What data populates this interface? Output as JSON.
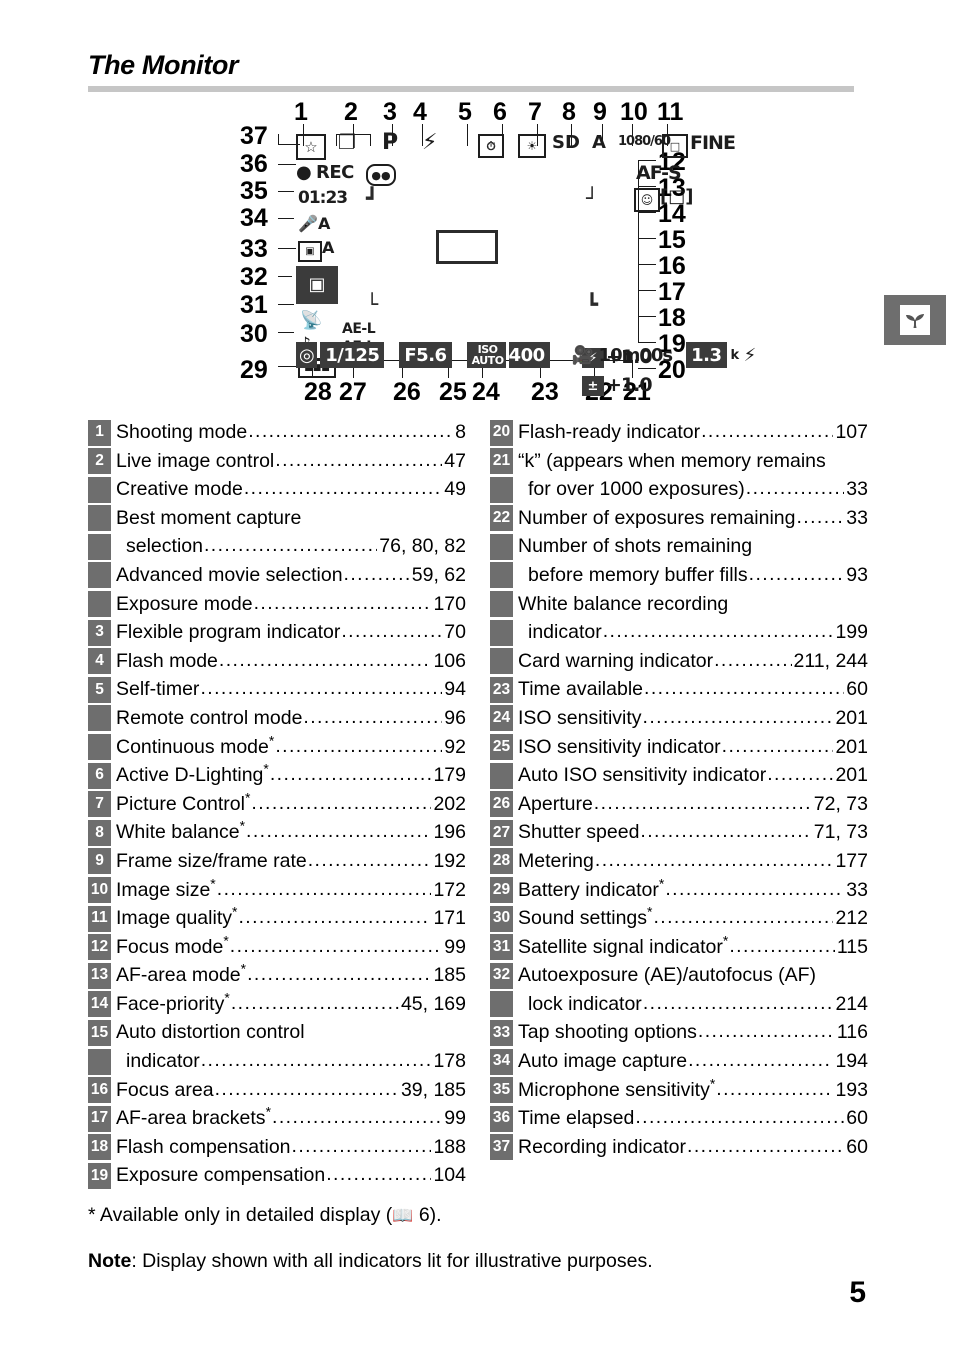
{
  "header": {
    "title": "The Monitor"
  },
  "side_tab": {
    "icon": "sprout-icon"
  },
  "figure": {
    "caption_numbers_top": [
      "1",
      "2",
      "3",
      "4",
      "5",
      "6",
      "7",
      "8",
      "9",
      "10",
      "11"
    ],
    "caption_numbers_bottom": [
      "28",
      "27",
      "26",
      "25",
      "24",
      "23",
      "22",
      "21"
    ],
    "caption_numbers_left": [
      "37",
      "36",
      "35",
      "34",
      "33",
      "32",
      "31",
      "30",
      "29"
    ],
    "caption_numbers_right": [
      "12",
      "13",
      "14",
      "15",
      "16",
      "17",
      "18",
      "19",
      "20"
    ],
    "display": {
      "shooting_mode_icon": "star-frame-icon",
      "live_image_control_icon": "stacked-frames-icon",
      "flexible_program": "P",
      "flash_mode_icon": "lightning-bolt-icon",
      "self_timer_icon": "self-timer-icon",
      "active_d_lighting_icon": "d-lighting-icon",
      "picture_control": "SD",
      "white_balance": "A",
      "frame_size_rate": "1080/60",
      "image_size_icon": "image-size-icon",
      "image_quality": "FINE",
      "focus_mode": "AF-S",
      "face_priority_icon": "face-priority-icon",
      "af_area_mode_icon": "af-area-mode-icon",
      "recording_indicator": "REC",
      "time_elapsed": "01:23",
      "microphone_sensitivity_icon": "microphone-icon",
      "microphone_level": "A",
      "auto_image_capture_icon": "auto-capture-icon",
      "auto_capture_level": "A",
      "tap_shooting_icon": "tap-shooting-icon",
      "satellite_icon": "satellite-icon",
      "sound_icon": "music-note-icon",
      "battery_icon": "battery-icon",
      "ae_lock": "AE-L",
      "af_lock": "AF-L",
      "metering_icon": "metering-icon",
      "shutter_speed": "1/125",
      "aperture": "F5.6",
      "iso_label": "ISO",
      "iso_auto_label": "AUTO",
      "iso_value": "400",
      "movie_icon": "movie-camera-icon",
      "time_available": "10m00s",
      "exposures_remaining": "1.3",
      "k_indicator": "k",
      "flash_ready_icon": "flash-ready-icon",
      "flash_compensation": "+1.0",
      "exposure_compensation": "+1.0",
      "flash_comp_icon": "flash-compensation-icon",
      "exp_comp_icon": "exposure-compensation-icon"
    }
  },
  "legend": {
    "left": [
      {
        "num": "1",
        "label": "Shooting mode",
        "page": "8",
        "indent": false
      },
      {
        "num": "2",
        "label": "Live image control",
        "page": "47",
        "indent": false
      },
      {
        "num": "",
        "label": "Creative mode ",
        "page": "49",
        "indent": false
      },
      {
        "num": "",
        "label": "Best moment capture",
        "page": "",
        "indent": false,
        "nodots": true
      },
      {
        "num": "",
        "label": "selection",
        "page": "76, 80, 82",
        "indent": true
      },
      {
        "num": "",
        "label": "Advanced movie selection",
        "page": "59, 62",
        "indent": false
      },
      {
        "num": "",
        "label": "Exposure mode",
        "page": "170",
        "indent": false
      },
      {
        "num": "3",
        "label": "Flexible program indicator",
        "page": "70",
        "indent": false
      },
      {
        "num": "4",
        "label": "Flash mode",
        "page": "106",
        "indent": false
      },
      {
        "num": "5",
        "label": "Self-timer",
        "page": "94",
        "indent": false
      },
      {
        "num": "",
        "label": "Remote control mode",
        "page": "96",
        "indent": false
      },
      {
        "num": "",
        "label": "Continuous mode",
        "page": "92",
        "indent": false,
        "star": true
      },
      {
        "num": "6",
        "label": "Active D-Lighting",
        "page": "179",
        "indent": false,
        "star": true
      },
      {
        "num": "7",
        "label": "Picture Control",
        "page": "202",
        "indent": false,
        "star": true
      },
      {
        "num": "8",
        "label": "White balance",
        "page": "196",
        "indent": false,
        "star": true
      },
      {
        "num": "9",
        "label": "Frame size/frame rate",
        "page": "192",
        "indent": false
      },
      {
        "num": "10",
        "label": "Image size",
        "page": "172",
        "indent": false,
        "star": true
      },
      {
        "num": "11",
        "label": "Image quality",
        "page": "171",
        "indent": false,
        "star": true
      },
      {
        "num": "12",
        "label": "Focus mode",
        "page": "99",
        "indent": false,
        "star": true
      },
      {
        "num": "13",
        "label": "AF-area mode",
        "page": "185",
        "indent": false,
        "star": true
      },
      {
        "num": "14",
        "label": "Face-priority",
        "page": "45, 169",
        "indent": false,
        "star": true
      },
      {
        "num": "15",
        "label": "Auto distortion control",
        "page": "",
        "indent": false,
        "nodots": true
      },
      {
        "num": "",
        "label": "indicator",
        "page": "178",
        "indent": true
      },
      {
        "num": "16",
        "label": "Focus area",
        "page": "39, 185",
        "indent": false
      },
      {
        "num": "17",
        "label": "AF-area brackets",
        "page": "99",
        "indent": false,
        "star": true
      },
      {
        "num": "18",
        "label": "Flash compensation",
        "page": "188",
        "indent": false
      },
      {
        "num": "19",
        "label": "Exposure compensation",
        "page": "104",
        "indent": false
      }
    ],
    "right": [
      {
        "num": "20",
        "label": "Flash-ready indicator",
        "page": "107",
        "indent": false
      },
      {
        "num": "21",
        "label": "“k” (appears when memory remains",
        "page": "",
        "indent": false,
        "nodots": true
      },
      {
        "num": "",
        "label": "for over 1000 exposures)",
        "page": "33",
        "indent": true
      },
      {
        "num": "22",
        "label": "Number of exposures remaining",
        "page": "33",
        "indent": false
      },
      {
        "num": "",
        "label": "Number of shots remaining",
        "page": "",
        "indent": false,
        "nodots": true
      },
      {
        "num": "",
        "label": "before memory buffer fills",
        "page": "93",
        "indent": true
      },
      {
        "num": "",
        "label": "White balance recording",
        "page": "",
        "indent": false,
        "nodots": true
      },
      {
        "num": "",
        "label": "indicator",
        "page": "199",
        "indent": true
      },
      {
        "num": "",
        "label": "Card warning indicator",
        "page": "211, 244",
        "indent": false
      },
      {
        "num": "23",
        "label": "Time available",
        "page": "60",
        "indent": false
      },
      {
        "num": "24",
        "label": "ISO sensitivity",
        "page": "201",
        "indent": false
      },
      {
        "num": "25",
        "label": "ISO sensitivity indicator",
        "page": "201",
        "indent": false
      },
      {
        "num": "",
        "label": "Auto ISO sensitivity indicator",
        "page": "201",
        "indent": false
      },
      {
        "num": "26",
        "label": "Aperture",
        "page": "72, 73",
        "indent": false
      },
      {
        "num": "27",
        "label": "Shutter speed",
        "page": "71, 73",
        "indent": false
      },
      {
        "num": "28",
        "label": "Metering",
        "page": "177",
        "indent": false
      },
      {
        "num": "29",
        "label": "Battery indicator",
        "page": "33",
        "indent": false,
        "star": true
      },
      {
        "num": "30",
        "label": "Sound settings",
        "page": "212",
        "indent": false,
        "star": true
      },
      {
        "num": "31",
        "label": "Satellite signal indicator",
        "page": "115",
        "indent": false,
        "star": true
      },
      {
        "num": "32",
        "label": "Autoexposure (AE)/autofocus (AF)",
        "page": "",
        "indent": false,
        "nodots": true
      },
      {
        "num": "",
        "label": "lock indicator",
        "page": "214",
        "indent": true
      },
      {
        "num": "33",
        "label": "Tap shooting options",
        "page": "116",
        "indent": false
      },
      {
        "num": "34",
        "label": "Auto image capture",
        "page": "194",
        "indent": false
      },
      {
        "num": "35",
        "label": "Microphone sensitivity",
        "page": "193",
        "indent": false,
        "star": true
      },
      {
        "num": "36",
        "label": "Time elapsed",
        "page": "60",
        "indent": false
      },
      {
        "num": "37",
        "label": "Recording indicator",
        "page": "60",
        "indent": false
      }
    ]
  },
  "footnote": {
    "prefix": "* Available only in detailed display (",
    "book_glyph": "📖",
    "suffix": " 6)."
  },
  "note": {
    "label": "Note",
    "text": ": Display shown with all indicators lit for illustrative purposes."
  },
  "page_number": "5"
}
